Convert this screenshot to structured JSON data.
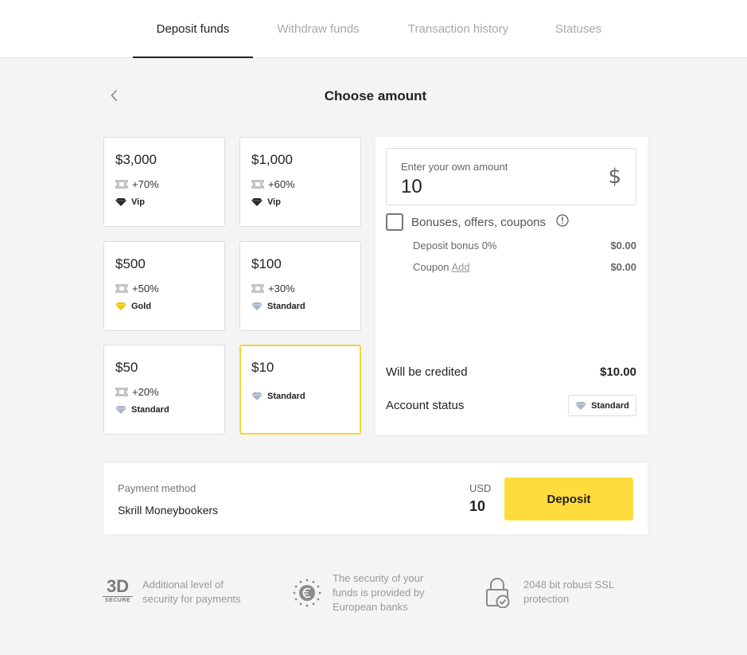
{
  "tabs": [
    {
      "label": "Deposit funds",
      "active": true
    },
    {
      "label": "Withdraw funds",
      "active": false
    },
    {
      "label": "Transaction history",
      "active": false
    },
    {
      "label": "Statuses",
      "active": false
    }
  ],
  "header": {
    "title": "Choose amount",
    "back_icon": "chevron-left-icon"
  },
  "amounts": [
    {
      "amount": "$3,000",
      "bonus": "+70%",
      "status": "Vip",
      "status_icon": "diamond-vip-icon"
    },
    {
      "amount": "$1,000",
      "bonus": "+60%",
      "status": "Vip",
      "status_icon": "diamond-vip-icon"
    },
    {
      "amount": "$500",
      "bonus": "+50%",
      "status": "Gold",
      "status_icon": "diamond-gold-icon"
    },
    {
      "amount": "$100",
      "bonus": "+30%",
      "status": "Standard",
      "status_icon": "diamond-standard-icon"
    },
    {
      "amount": "$50",
      "bonus": "+20%",
      "status": "Standard",
      "status_icon": "diamond-standard-icon"
    },
    {
      "amount": "$10",
      "bonus": "",
      "status": "Standard",
      "status_icon": "diamond-standard-icon",
      "selected": true
    }
  ],
  "custom_amount": {
    "label": "Enter your own amount",
    "value": "10",
    "currency_symbol": "$"
  },
  "bonuses": {
    "label": "Bonuses, offers, coupons",
    "checked": false,
    "deposit_bonus": {
      "label": "Deposit bonus 0%",
      "value": "$0.00"
    },
    "coupon": {
      "label": "Coupon",
      "link": "Add",
      "value": "$0.00"
    }
  },
  "summary": {
    "credited_label": "Will be credited",
    "credited_value": "$10.00",
    "account_status_label": "Account status",
    "account_status_value": "Standard"
  },
  "payment": {
    "method_label": "Payment method",
    "method_value": "Skrill Moneybookers",
    "currency": "USD",
    "amount": "10",
    "deposit_button": "Deposit"
  },
  "security": [
    {
      "icon": "3d-secure-icon",
      "badge_main": "3D",
      "badge_sub": "SECURE",
      "line1": "Additional level of",
      "line2": "security for payments",
      "line3": ""
    },
    {
      "icon": "euro-stars-icon",
      "line1": "The security of your",
      "line2": "funds is provided by",
      "line3": "European banks"
    },
    {
      "icon": "lock-check-icon",
      "line1": "2048 bit robust SSL",
      "line2": "protection",
      "line3": ""
    }
  ],
  "colors": {
    "accent_yellow": "#ffdc3c",
    "selected_border": "#f5d43a",
    "gold": "#f2c200",
    "vip": "#2b2b2b",
    "standard": "#a9b4c6"
  }
}
